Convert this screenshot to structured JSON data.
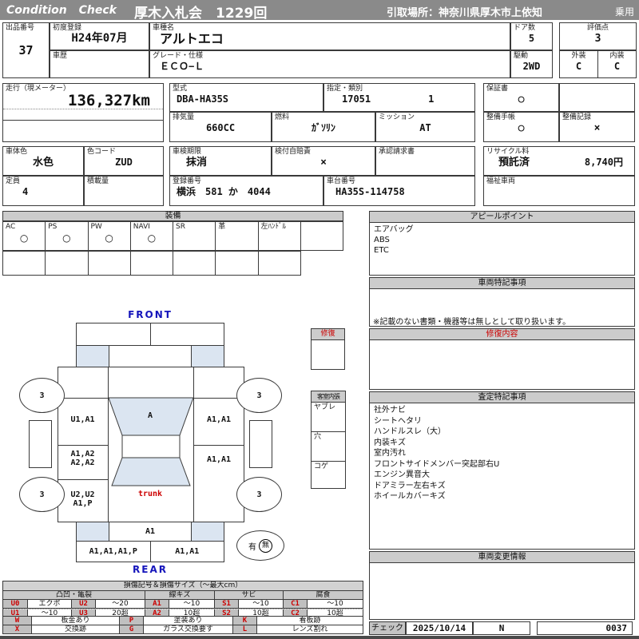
{
  "header": {
    "brand": "Condition  Check",
    "title": "厚木入札会　1229回",
    "pickup": "引取場所：神奈川県厚木市上依知",
    "usage": "乗用"
  },
  "info": {
    "lot_label": "出品番号",
    "lot_value": "37",
    "first_reg_label": "初度登録",
    "first_reg_value": "H24年07月",
    "history_label": "車歴",
    "model_label": "車種名",
    "model_value": "アルトエコ",
    "grade_label": "グレード・仕様",
    "grade_value": "ＥＣＯ−Ｌ",
    "doors_label": "ドア数",
    "doors_value": "5",
    "drive_label": "駆動",
    "drive_value": "2WD",
    "score_label": "評価点",
    "score_value": "3",
    "exterior_label": "外装",
    "exterior_value": "C",
    "interior_label": "内装",
    "interior_value": "C",
    "mileage_label": "走行（現メーター）",
    "mileage_value": "136,327km",
    "model_code_label": "型式",
    "model_code_value": "DBA-HA35S",
    "class_label": "指定・類別",
    "class_value1": "17051",
    "class_value2": "1",
    "warranty_label": "保証書",
    "warranty_value": "○",
    "displacement_label": "排気量",
    "displacement_value": "660CC",
    "fuel_label": "燃料",
    "fuel_value": "ｶﾞｿﾘﾝ",
    "mission_label": "ミッション",
    "mission_value": "AT",
    "book_label": "整備手帳",
    "book_value": "○",
    "record_label": "整備記録",
    "record_value": "×",
    "body_color_label": "車体色",
    "body_color_value": "水色",
    "color_code_label": "色コード",
    "color_code_value": "ZUD",
    "inspection_label": "車検期限",
    "inspection_value": "抹消",
    "jibaiseki_label": "検付自賠責",
    "jibaiseki_value": "×",
    "approval_label": "承認請求書",
    "capacity_label": "定員",
    "capacity_value": "4",
    "load_label": "積載量",
    "reg_label": "登録番号",
    "reg_value": "横浜　581 か　4044",
    "chassis_label": "車台番号",
    "chassis_value": "HA35S-114758",
    "recycle_label": "リサイクル料",
    "recycle_status": "預託済",
    "recycle_fee": "8,740円",
    "welfare_label": "福祉車両"
  },
  "equipment": {
    "title": "装備",
    "items": [
      {
        "label": "AC",
        "value": "○"
      },
      {
        "label": "PS",
        "value": "○"
      },
      {
        "label": "PW",
        "value": "○"
      },
      {
        "label": "NAVI",
        "value": "○"
      },
      {
        "label": "SR",
        "value": ""
      },
      {
        "label": "革",
        "value": ""
      },
      {
        "label": "左ﾊﾝﾄﾞﾙ",
        "value": ""
      },
      {
        "label": "",
        "value": ""
      }
    ]
  },
  "panels": {
    "appeal_title": "アピールポイント",
    "appeal_lines": [
      "エアバッグ",
      "ABS",
      "ETC"
    ],
    "vehicle_notes_title": "車両特記事項",
    "vehicle_note": "※記載のない書類・機器等は無しとして取り扱います。",
    "repair_title": "修復内容",
    "assessment_title": "査定特記事項",
    "assessment_lines": [
      "社外ナビ",
      "シートヘタリ",
      "ハンドルスレ（大）",
      "内装キズ",
      "室内汚れ",
      "フロントサイドメンバー突起部右U",
      "エンジン異音大",
      "ドアミラー左右キズ",
      "ホイールカバーキズ"
    ],
    "change_title": "車両変更情報",
    "check_label": "チェック",
    "check_date": "2025/10/14",
    "check_inspector": "N",
    "check_number": "0037"
  },
  "diagram": {
    "front": "FRONT",
    "rear": "REAR",
    "trunk": "trunk",
    "windshield": "A",
    "left_front_door": "U1,A1",
    "right_front_door": "A1,A1",
    "left_rear_door_1": "A1,A2",
    "left_rear_door_2": "A2,A2",
    "right_rear_door": "A1,A1",
    "left_quarter_1": "U2,U2",
    "left_quarter_2": "A1,P",
    "rear_panel": "A1",
    "rear_bumper_left": "A1,A1,A1,P",
    "rear_bumper_right": "A1,A1",
    "tires": [
      "3",
      "3",
      "3",
      "3"
    ],
    "record_yes": "有",
    "record_no": "無",
    "repair_box_title": "修復",
    "interior_title": "客室内張",
    "interior_rows": [
      "ヤブレ",
      "穴",
      "コゲ"
    ]
  },
  "legend": {
    "title": "損傷記号＆損傷サイズ（〜最大cm）",
    "groups": [
      "凸凹・亀裂",
      "線キズ",
      "サビ",
      "腐食"
    ],
    "rows": [
      [
        "U0",
        "エクボ",
        "U2",
        "〜20",
        "A1",
        "〜10",
        "S1",
        "〜10",
        "C1",
        "〜10"
      ],
      [
        "U1",
        "〜10",
        "U3",
        "20超",
        "A2",
        "10超",
        "S2",
        "10超",
        "C2",
        "10超"
      ]
    ],
    "extra": [
      [
        "W",
        "板金あり",
        "P",
        "塗装あり",
        "K",
        "看板跡"
      ],
      [
        "X",
        "交換跡",
        "G",
        "ガラス交換要す",
        "L",
        "レンズ割れ"
      ]
    ]
  },
  "colors": {
    "header_bg": "#8a8a8a",
    "section_header_bg": "#cccccc",
    "glass_blue": "#dbe5f1",
    "accent_red": "#cc0000",
    "accent_blue": "#1515bb"
  }
}
